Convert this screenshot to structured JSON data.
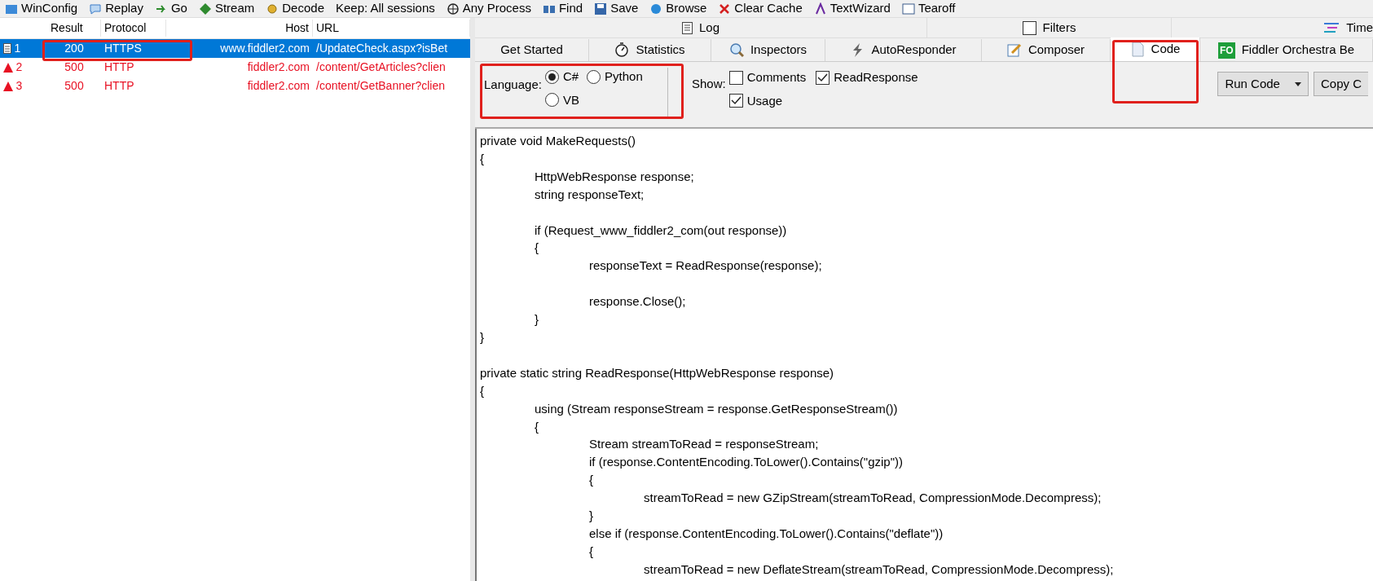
{
  "toolbar": [
    {
      "label": "WinConfig"
    },
    {
      "label": "Replay"
    },
    {
      "label": "Go"
    },
    {
      "label": "Stream"
    },
    {
      "label": "Decode"
    },
    {
      "label": "Keep: All sessions"
    },
    {
      "label": "Any Process"
    },
    {
      "label": "Find"
    },
    {
      "label": "Save"
    },
    {
      "label": "Browse"
    },
    {
      "label": "Clear Cache"
    },
    {
      "label": "TextWizard"
    },
    {
      "label": "Tearoff"
    }
  ],
  "sessions": {
    "columns": [
      "Result",
      "Protocol",
      "Host",
      "URL"
    ],
    "rows": [
      {
        "number": "1",
        "result": "200",
        "protocol": "HTTPS",
        "host": "www.fiddler2.com",
        "url": "/UpdateCheck.aspx?isBet",
        "kind": "ok",
        "selected": true,
        "highlighted": true
      },
      {
        "number": "2",
        "result": "500",
        "protocol": "HTTP",
        "host": "fiddler2.com",
        "url": "/content/GetArticles?clien",
        "kind": "error",
        "selected": false,
        "highlighted": false
      },
      {
        "number": "3",
        "result": "500",
        "protocol": "HTTP",
        "host": "fiddler2.com",
        "url": "/content/GetBanner?clien",
        "kind": "error",
        "selected": false,
        "highlighted": false
      }
    ]
  },
  "log_tab": {
    "label": "Log"
  },
  "filters_tab": {
    "label": "Filters",
    "checked": false
  },
  "timeline_tab": {
    "label": "Time"
  },
  "tabs": [
    {
      "label": "Get Started",
      "selected": false,
      "highlighted": false
    },
    {
      "label": "Statistics",
      "selected": false,
      "highlighted": false
    },
    {
      "label": "Inspectors",
      "selected": false,
      "highlighted": false
    },
    {
      "label": "AutoResponder",
      "selected": false,
      "highlighted": false
    },
    {
      "label": "Composer",
      "selected": false,
      "highlighted": false
    },
    {
      "label": "Code",
      "selected": true,
      "highlighted": true
    },
    {
      "label": "Fiddler Orchestra Be",
      "selected": false,
      "highlighted": false,
      "badge": "FO"
    }
  ],
  "options": {
    "language": {
      "label": "Language:",
      "highlighted": true,
      "options": [
        {
          "label": "C#",
          "selected": true
        },
        {
          "label": "Python",
          "selected": false
        },
        {
          "label": "VB",
          "selected": false
        }
      ]
    },
    "show": {
      "label": "Show:",
      "options": [
        {
          "label": "Comments",
          "checked": false
        },
        {
          "label": "ReadResponse",
          "checked": true
        },
        {
          "label": "Usage",
          "checked": true
        }
      ]
    },
    "buttons": [
      {
        "label": "Run Code",
        "kind": "dropdown"
      },
      {
        "label": "Copy C",
        "kind": "plain"
      }
    ]
  },
  "code": "private void MakeRequests()\n{\n\tHttpWebResponse response;\n\tstring responseText;\n\n\tif (Request_www_fiddler2_com(out response))\n\t{\n\t\tresponseText = ReadResponse(response);\n\n\t\tresponse.Close();\n\t}\n}\n\nprivate static string ReadResponse(HttpWebResponse response)\n{\n\tusing (Stream responseStream = response.GetResponseStream())\n\t{\n\t\tStream streamToRead = responseStream;\n\t\tif (response.ContentEncoding.ToLower().Contains(\"gzip\"))\n\t\t{\n\t\t\tstreamToRead = new GZipStream(streamToRead, CompressionMode.Decompress);\n\t\t}\n\t\telse if (response.ContentEncoding.ToLower().Contains(\"deflate\"))\n\t\t{\n\t\t\tstreamToRead = new DeflateStream(streamToRead, CompressionMode.Decompress);"
}
